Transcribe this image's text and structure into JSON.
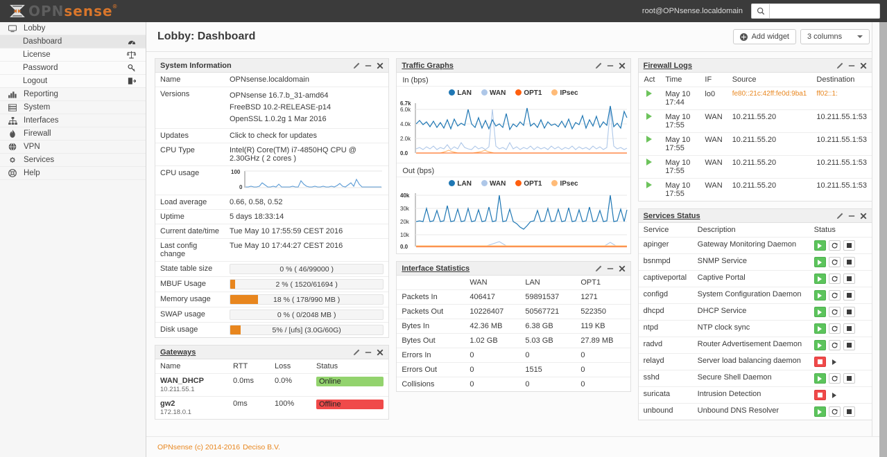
{
  "topbar": {
    "logo_opn": "OPN",
    "logo_sense": "sense",
    "user": "root@OPNsense.localdomain",
    "search_placeholder": "",
    "search_value": "",
    "search_icon": "search-icon"
  },
  "sidebar": {
    "groups": [
      {
        "label": "Lobby",
        "icon": "desktop-icon",
        "children": [
          {
            "label": "Dashboard",
            "icon": "dashboard-gauge-icon",
            "active": true
          },
          {
            "label": "License",
            "icon": "balance-scale-icon",
            "active": false
          },
          {
            "label": "Password",
            "icon": "key-icon",
            "active": false
          },
          {
            "label": "Logout",
            "icon": "sign-out-icon",
            "active": false
          }
        ]
      },
      {
        "label": "Reporting",
        "icon": "bar-chart-icon",
        "children": []
      },
      {
        "label": "System",
        "icon": "server-icon",
        "children": []
      },
      {
        "label": "Interfaces",
        "icon": "sitemap-icon",
        "children": []
      },
      {
        "label": "Firewall",
        "icon": "fire-icon",
        "children": []
      },
      {
        "label": "VPN",
        "icon": "globe-icon",
        "children": []
      },
      {
        "label": "Services",
        "icon": "gear-icon",
        "children": []
      },
      {
        "label": "Help",
        "icon": "life-ring-icon",
        "children": []
      }
    ]
  },
  "page": {
    "title": "Lobby: Dashboard",
    "add_widget_label": "Add widget",
    "columns_label": "3 columns"
  },
  "panel_tools": {
    "edit": "pencil-icon",
    "minimize": "minus-icon",
    "close": "close-icon"
  },
  "system_information": {
    "title": "System Information",
    "rows": [
      {
        "label": "Name",
        "value": "OPNsense.localdomain"
      },
      {
        "label": "Versions",
        "value": "OPNsense 16.7.b_31-amd64\nFreeBSD 10.2-RELEASE-p14\nOpenSSL 1.0.2g 1 Mar 2016"
      },
      {
        "label": "Updates",
        "value": "Click to check for updates",
        "link": true
      },
      {
        "label": "CPU Type",
        "value": "Intel(R) Core(TM) i7-4850HQ CPU @ 2.30GHz ( 2 cores )"
      },
      {
        "label": "CPU usage",
        "value": "",
        "sparkline": true
      },
      {
        "label": "Load average",
        "value": "0.66, 0.58, 0.52"
      },
      {
        "label": "Uptime",
        "value": "5 days 18:33:14"
      },
      {
        "label": "Current date/time",
        "value": "Tue May 10 17:55:59 CEST 2016"
      },
      {
        "label": "Last config change",
        "value": "Tue May 10 17:44:27 CEST 2016"
      }
    ],
    "cpu_chart": {
      "y_top": "100",
      "y_bottom": "0"
    },
    "bars": [
      {
        "label": "State table size",
        "text": "0 % ( 46/99000 )",
        "percent": 0
      },
      {
        "label": "MBUF Usage",
        "text": "2 % ( 1520/61694 )",
        "percent": 2
      },
      {
        "label": "Memory usage",
        "text": "18 % ( 178/990 MB )",
        "percent": 18
      },
      {
        "label": "SWAP usage",
        "text": "0 % ( 0/2048 MB )",
        "percent": 0
      },
      {
        "label": "Disk usage",
        "text": "5% / [ufs] (3.0G/60G)",
        "percent": 5
      }
    ]
  },
  "gateways": {
    "title": "Gateways",
    "headers": [
      "Name",
      "RTT",
      "Loss",
      "Status"
    ],
    "rows": [
      {
        "name": "WAN_DHCP",
        "ip": "10.211.55.1",
        "rtt": "0.0ms",
        "loss": "0.0%",
        "status": "Online",
        "state": "online"
      },
      {
        "name": "gw2",
        "ip": "172.18.0.1",
        "rtt": "0ms",
        "loss": "100%",
        "status": "Offline",
        "state": "offline"
      }
    ]
  },
  "traffic_graphs": {
    "title": "Traffic Graphs",
    "in_label": "In (bps)",
    "out_label": "Out (bps)",
    "legend": [
      {
        "name": "LAN",
        "color": "#1f77b4"
      },
      {
        "name": "WAN",
        "color": "#aec7e8"
      },
      {
        "name": "OPT1",
        "color": "#ff5f0e"
      },
      {
        "name": "IPsec",
        "color": "#ffbb78"
      }
    ],
    "chart_data": [
      {
        "type": "line",
        "title": "In (bps)",
        "xlabel": "",
        "ylabel": "bps",
        "ylim": [
          0,
          6700
        ],
        "yticks": [
          "0.0",
          "2.0k",
          "4.0k",
          "6.0k",
          "6.7k"
        ],
        "legend_position": "top-right",
        "grid": true,
        "series": [
          {
            "name": "LAN",
            "color": "#1f77b4",
            "values": [
              4000,
              4500,
              3900,
              4300,
              3600,
              4400,
              3500,
              4200,
              3400,
              4600,
              3300,
              4700,
              3700,
              4100,
              3800,
              6000,
              4000,
              3500,
              4800,
              3400,
              4500,
              3300,
              4600,
              3700,
              4000,
              3500,
              5400,
              3200,
              4000,
              3600,
              4300,
              3800,
              6200,
              3700,
              4100,
              3500,
              4600,
              3400,
              4300,
              3800,
              4000,
              3600,
              4400,
              3500,
              4700,
              3300,
              4200,
              3900,
              5000,
              3400,
              4600,
              3700,
              4900,
              3500,
              4300,
              3800,
              6500,
              3600,
              4200,
              3400,
              5700,
              3700,
              4000,
              3300,
              5000
            ]
          },
          {
            "name": "WAN",
            "color": "#aec7e8",
            "values": [
              600,
              700,
              500,
              800,
              600,
              900,
              500,
              700,
              600,
              1000,
              500,
              800,
              600,
              1400,
              700,
              600,
              500,
              900,
              600,
              700,
              500,
              800,
              6000,
              900,
              600,
              700,
              500,
              1400,
              600,
              800,
              500,
              700,
              600,
              900,
              500,
              800,
              600,
              700,
              500,
              900,
              600,
              800,
              500,
              700,
              600,
              900,
              500,
              800,
              600,
              700,
              500,
              900,
              600,
              800,
              500,
              700,
              600,
              6000,
              500,
              900,
              600,
              700,
              500,
              800,
              600
            ]
          },
          {
            "name": "OPT1",
            "color": "#ff5f0e",
            "values": [
              0,
              0,
              0,
              0,
              0,
              0,
              0,
              0,
              0,
              0,
              0,
              0,
              0,
              0,
              0,
              0,
              0,
              0,
              0,
              0,
              0,
              0,
              0,
              0,
              0,
              0,
              0,
              0,
              0,
              0,
              0,
              0,
              0,
              0,
              0,
              0,
              0,
              0,
              0,
              0,
              0,
              0,
              0,
              0,
              0,
              0,
              0,
              0,
              0,
              0,
              0,
              0,
              0,
              0,
              0,
              0,
              0,
              0,
              0,
              0,
              0,
              0,
              0,
              0,
              0
            ]
          },
          {
            "name": "IPsec",
            "color": "#ffbb78",
            "values": [
              0,
              0,
              0,
              0,
              0,
              0,
              0,
              0,
              0,
              200,
              300,
              100,
              0,
              0,
              0,
              0,
              0,
              0,
              0,
              150,
              200,
              100,
              0,
              0,
              0,
              0,
              0,
              0,
              0,
              0,
              0,
              0,
              0,
              0,
              0,
              0,
              0,
              0,
              0,
              0,
              0,
              0,
              0,
              0,
              0,
              0,
              0,
              0,
              0,
              0,
              0,
              0,
              0,
              0,
              0,
              0,
              0,
              0,
              0,
              0,
              0,
              0,
              0,
              0,
              0
            ]
          }
        ]
      },
      {
        "type": "line",
        "title": "Out (bps)",
        "xlabel": "",
        "ylabel": "bps",
        "ylim": [
          0,
          42000
        ],
        "yticks": [
          "0.0",
          "10k",
          "20k",
          "30k",
          "40k"
        ],
        "legend_position": "top-right",
        "grid": true,
        "series": [
          {
            "name": "LAN",
            "color": "#1f77b4",
            "values": [
              20000,
              20500,
              20000,
              30000,
              20000,
              20200,
              28000,
              20000,
              20300,
              33000,
              20000,
              20200,
              29000,
              20000,
              20500,
              30000,
              20000,
              20300,
              28500,
              20000,
              20200,
              31000,
              20000,
              20500,
              40000,
              20000,
              20300,
              29000,
              20000,
              19000,
              17000,
              16000,
              18500,
              20000,
              20200,
              28000,
              20000,
              20500,
              30000,
              20000,
              20300,
              29000,
              20000,
              20200,
              30500,
              20000,
              20400,
              29500,
              20000,
              20200,
              31000,
              20000,
              20500,
              28000,
              20000,
              20300,
              40000,
              20000,
              20200,
              29000,
              20000,
              20500,
              30000
            ]
          },
          {
            "name": "WAN",
            "color": "#aec7e8",
            "values": [
              300,
              400,
              300,
              500,
              300,
              400,
              300,
              500,
              300,
              400,
              300,
              500,
              300,
              400,
              300,
              500,
              300,
              400,
              300,
              500,
              300,
              400,
              300,
              500,
              2500,
              300,
              400,
              300,
              500,
              300,
              400,
              300,
              500,
              300,
              400,
              300,
              500,
              300,
              400,
              300,
              500,
              300,
              400,
              300,
              500,
              300,
              400,
              300,
              500,
              300,
              400,
              300,
              500,
              300,
              400,
              300,
              2200,
              300,
              400,
              300,
              500,
              300,
              400
            ]
          },
          {
            "name": "OPT1",
            "color": "#ff5f0e",
            "values": [
              100,
              100,
              100,
              100,
              100,
              100,
              100,
              100,
              100,
              100,
              100,
              100,
              100,
              100,
              100,
              100,
              100,
              100,
              100,
              100,
              100,
              100,
              100,
              100,
              100,
              100,
              100,
              100,
              100,
              100,
              100,
              100,
              100,
              100,
              100,
              100,
              100,
              100,
              100,
              100,
              100,
              100,
              100,
              100,
              100,
              100,
              100,
              100,
              100,
              100,
              100,
              100,
              100,
              100,
              100,
              100,
              100,
              100,
              100,
              100,
              100,
              100,
              100
            ]
          },
          {
            "name": "IPsec",
            "color": "#ffbb78",
            "values": [
              400,
              400,
              400,
              400,
              400,
              400,
              400,
              400,
              400,
              400,
              400,
              400,
              400,
              400,
              400,
              400,
              400,
              400,
              400,
              400,
              400,
              400,
              400,
              400,
              400,
              400,
              400,
              400,
              400,
              400,
              400,
              400,
              400,
              400,
              400,
              400,
              400,
              400,
              400,
              400,
              400,
              400,
              400,
              400,
              400,
              400,
              400,
              400,
              400,
              400,
              400,
              400,
              400,
              400,
              400,
              400,
              400,
              400,
              400,
              400,
              400,
              400,
              400
            ]
          }
        ]
      }
    ]
  },
  "interface_statistics": {
    "title": "Interface Statistics",
    "headers": [
      "",
      "WAN",
      "LAN",
      "OPT1"
    ],
    "rows": [
      {
        "label": "Packets In",
        "values": [
          "406417",
          "59891537",
          "1271"
        ]
      },
      {
        "label": "Packets Out",
        "values": [
          "10226407",
          "50567721",
          "522350"
        ]
      },
      {
        "label": "Bytes In",
        "values": [
          "42.36 MB",
          "6.38 GB",
          "119 KB"
        ]
      },
      {
        "label": "Bytes Out",
        "values": [
          "1.02 GB",
          "5.03 GB",
          "27.89 MB"
        ]
      },
      {
        "label": "Errors In",
        "values": [
          "0",
          "0",
          "0"
        ]
      },
      {
        "label": "Errors Out",
        "values": [
          "0",
          "1515",
          "0"
        ]
      },
      {
        "label": "Collisions",
        "values": [
          "0",
          "0",
          "0"
        ]
      }
    ]
  },
  "firewall_logs": {
    "title": "Firewall Logs",
    "headers": [
      "Act",
      "Time",
      "IF",
      "Source",
      "Destination"
    ],
    "rows": [
      {
        "act": "pass-icon",
        "time": "May 10 17:44",
        "if": "lo0",
        "source": "fe80::21c:42ff:fe0d:9ba1",
        "destination": "ff02::1:",
        "highlight": true
      },
      {
        "act": "pass-icon",
        "time": "May 10 17:55",
        "if": "WAN",
        "source": "10.211.55.20",
        "destination": "10.211.55.1:53",
        "highlight": false
      },
      {
        "act": "pass-icon",
        "time": "May 10 17:55",
        "if": "WAN",
        "source": "10.211.55.20",
        "destination": "10.211.55.1:53",
        "highlight": false
      },
      {
        "act": "pass-icon",
        "time": "May 10 17:55",
        "if": "WAN",
        "source": "10.211.55.20",
        "destination": "10.211.55.1:53",
        "highlight": false
      },
      {
        "act": "pass-icon",
        "time": "May 10 17:55",
        "if": "WAN",
        "source": "10.211.55.20",
        "destination": "10.211.55.1:53",
        "highlight": false
      }
    ]
  },
  "services_status": {
    "title": "Services Status",
    "headers": [
      "Service",
      "Description",
      "Status"
    ],
    "rows": [
      {
        "service": "apinger",
        "description": "Gateway Monitoring Daemon",
        "state": "running"
      },
      {
        "service": "bsnmpd",
        "description": "SNMP Service",
        "state": "running"
      },
      {
        "service": "captiveportal",
        "description": "Captive Portal",
        "state": "running"
      },
      {
        "service": "configd",
        "description": "System Configuration Daemon",
        "state": "running"
      },
      {
        "service": "dhcpd",
        "description": "DHCP Service",
        "state": "running"
      },
      {
        "service": "ntpd",
        "description": "NTP clock sync",
        "state": "running"
      },
      {
        "service": "radvd",
        "description": "Router Advertisement Daemon",
        "state": "running"
      },
      {
        "service": "relayd",
        "description": "Server load balancing daemon",
        "state": "stopped"
      },
      {
        "service": "sshd",
        "description": "Secure Shell Daemon",
        "state": "running"
      },
      {
        "service": "suricata",
        "description": "Intrusion Detection",
        "state": "stopped"
      },
      {
        "service": "unbound",
        "description": "Unbound DNS Resolver",
        "state": "running"
      }
    ]
  },
  "footer": {
    "part1": "OPNsense (c) 2014-2016",
    "part2": "Deciso B.V."
  },
  "colors": {
    "accent": "#e8861e",
    "topbar": "#3b3b3b",
    "online": "#93d36e",
    "offline": "#f04a4a",
    "running": "#5cc45c"
  }
}
